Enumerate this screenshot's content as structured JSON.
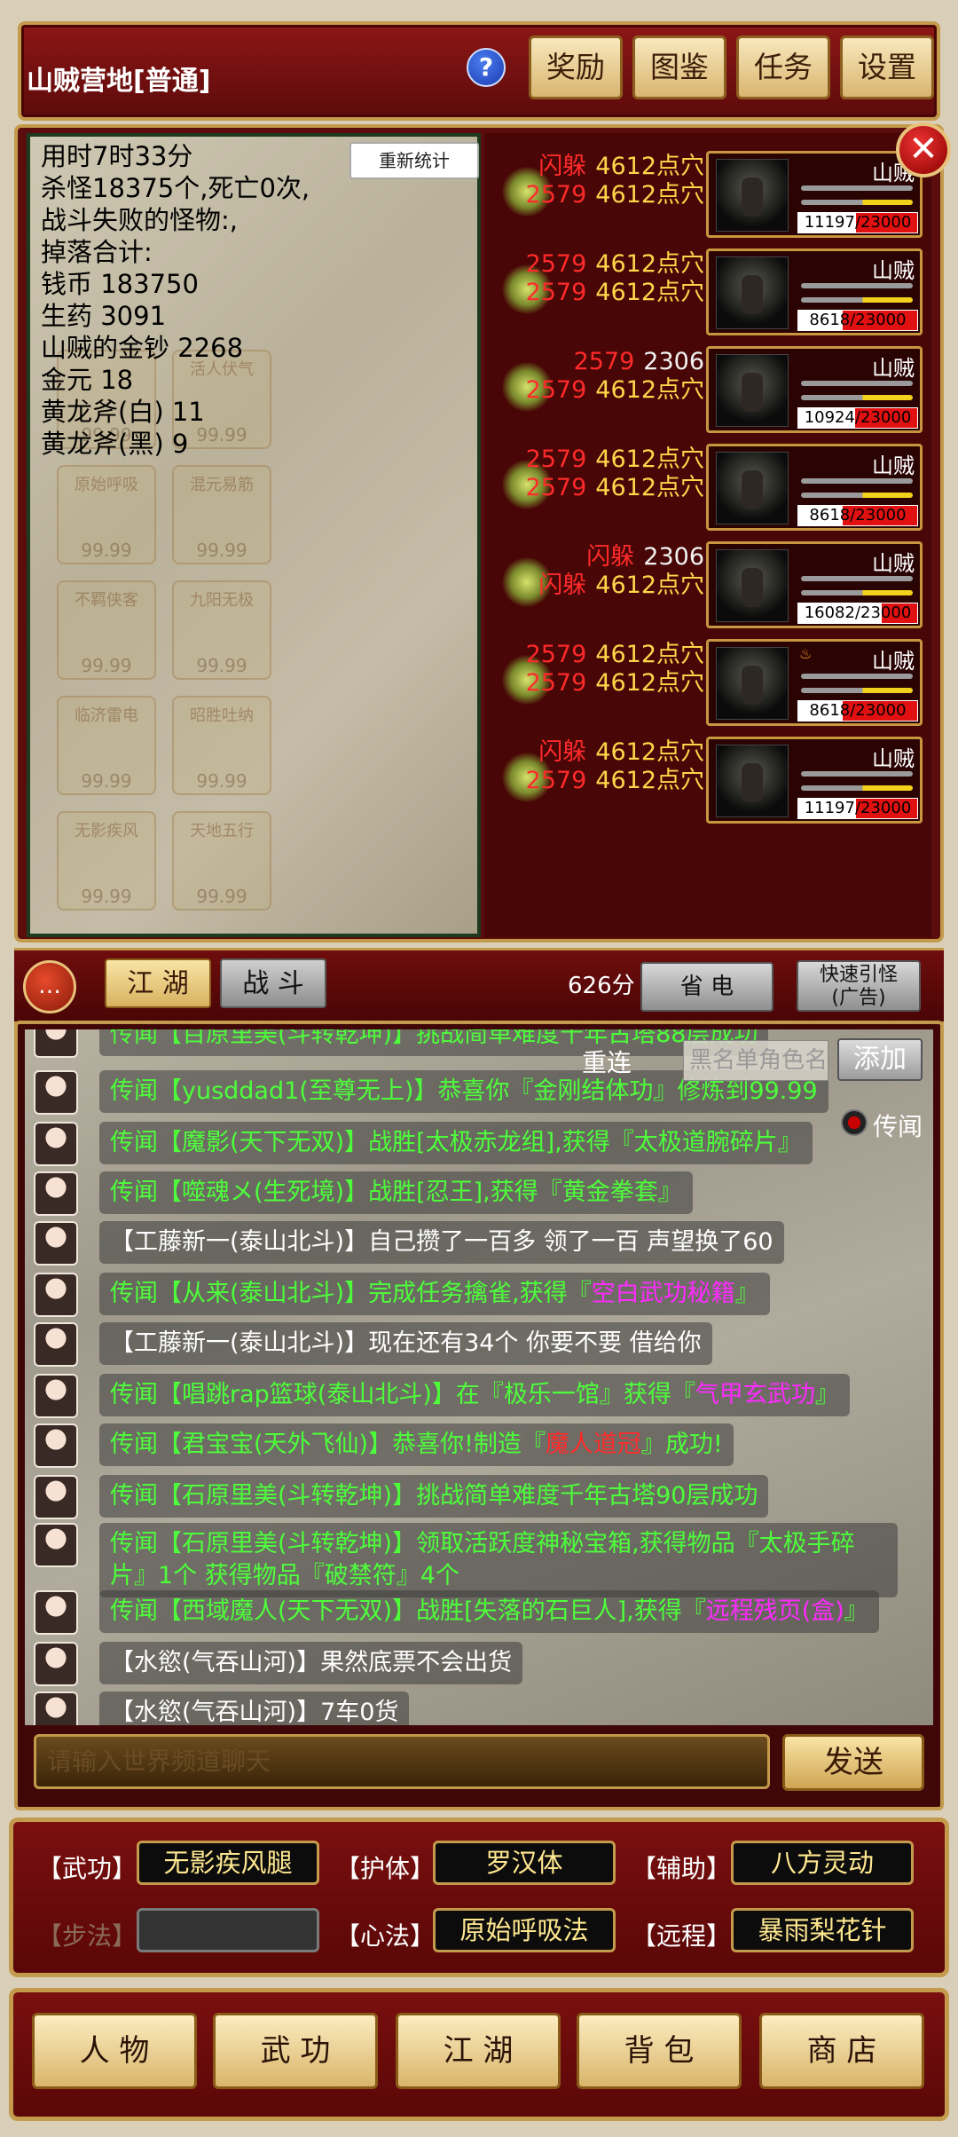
{
  "header": {
    "location": "山贼营地[普通]",
    "help_symbol": "?",
    "buttons": [
      "奖励",
      "图鉴",
      "任务",
      "设置"
    ]
  },
  "stats": {
    "recount_label": "重新统计",
    "lines": [
      "用时7时33分",
      "杀怪18375个,死亡0次,",
      "战斗失败的怪物:,",
      "掉落合计:",
      "钱币 183750",
      "生药 3091",
      "山贼的金钞 2268",
      "金元 18",
      "黄龙斧(白) 11",
      "黄龙斧(黑) 9"
    ],
    "faded_skills": [
      {
        "name": "",
        "value": "99.99"
      },
      {
        "name": "活人伏气",
        "value": "99.99"
      },
      {
        "name": "原始呼吸",
        "value": "99.99"
      },
      {
        "name": "混元易筋",
        "value": "99.99"
      },
      {
        "name": "不羁侠客",
        "value": "99.99"
      },
      {
        "name": "九阳无极",
        "value": "99.99"
      },
      {
        "name": "临济雷电",
        "value": "99.99"
      },
      {
        "name": "昭胜吐纳",
        "value": "99.99"
      },
      {
        "name": "无影疾风",
        "value": "99.99"
      },
      {
        "name": "天地五行",
        "value": "99.99"
      }
    ]
  },
  "close_symbol": "✕",
  "enemies": [
    {
      "name": "山贼",
      "line1": [
        {
          "t": "闪躲",
          "c": "red"
        },
        {
          "t": "4612点穴",
          "c": "yel"
        }
      ],
      "line2": [
        {
          "t": "2579",
          "c": "red"
        },
        {
          "t": "4612点穴",
          "c": "yel"
        }
      ],
      "hp": "11197/23000",
      "hp_fraction": 0.487
    },
    {
      "name": "山贼",
      "line1": [
        {
          "t": "2579",
          "c": "red"
        },
        {
          "t": "4612点穴",
          "c": "yel"
        }
      ],
      "line2": [
        {
          "t": "2579",
          "c": "red"
        },
        {
          "t": "4612点穴",
          "c": "yel"
        }
      ],
      "hp": "8618/23000",
      "hp_fraction": 0.375
    },
    {
      "name": "山贼",
      "line1": [
        {
          "t": "2579",
          "c": "red"
        },
        {
          "t": "2306",
          "c": "wht"
        }
      ],
      "line2": [
        {
          "t": "2579",
          "c": "red"
        },
        {
          "t": "4612点穴",
          "c": "yel"
        }
      ],
      "hp": "10924/23000",
      "hp_fraction": 0.475
    },
    {
      "name": "山贼",
      "line1": [
        {
          "t": "2579",
          "c": "red"
        },
        {
          "t": "4612点穴",
          "c": "yel"
        }
      ],
      "line2": [
        {
          "t": "2579",
          "c": "red"
        },
        {
          "t": "4612点穴",
          "c": "yel"
        }
      ],
      "hp": "8618/23000",
      "hp_fraction": 0.375
    },
    {
      "name": "山贼",
      "line1": [
        {
          "t": "闪躲",
          "c": "red"
        },
        {
          "t": "2306",
          "c": "wht"
        }
      ],
      "line2": [
        {
          "t": "闪躲",
          "c": "red"
        },
        {
          "t": "4612点穴",
          "c": "yel"
        }
      ],
      "hp": "16082/23000",
      "hp_fraction": 0.699
    },
    {
      "name": "山贼",
      "line1": [
        {
          "t": "2579",
          "c": "red"
        },
        {
          "t": "4612点穴",
          "c": "yel"
        }
      ],
      "line2": [
        {
          "t": "2579",
          "c": "red"
        },
        {
          "t": "4612点穴",
          "c": "yel"
        }
      ],
      "hp": "8618/23000",
      "hp_fraction": 0.375,
      "burning": true
    },
    {
      "name": "山贼",
      "line1": [
        {
          "t": "闪躲",
          "c": "red"
        },
        {
          "t": "4612点穴",
          "c": "yel"
        }
      ],
      "line2": [
        {
          "t": "2579",
          "c": "red"
        },
        {
          "t": "4612点穴",
          "c": "yel"
        }
      ],
      "hp": "11197/23000",
      "hp_fraction": 0.487
    }
  ],
  "tabs": {
    "chat_icon": "…",
    "jianghu": "江 湖",
    "battle": "战 斗",
    "score": "626分",
    "power_save": "省 电",
    "quick_lure": "快速引怪\n(广告)"
  },
  "chat": {
    "reconnect": "重连",
    "blacklist_placeholder": "黑名单角色名",
    "add_label": "添加",
    "channel_label": "传闻",
    "input_placeholder": "请输入世界频道聊天",
    "send_label": "发送",
    "messages": [
      {
        "segs": [
          {
            "c": "g",
            "t": "传闻【百原里美(斗转乾坤)】挑战简单难度千年古塔88层成功"
          }
        ]
      },
      {
        "segs": [
          {
            "c": "g",
            "t": "传闻【yusddad1(至尊无上)】恭喜你『金刚结体功』修炼到99.99"
          }
        ]
      },
      {
        "segs": [
          {
            "c": "g",
            "t": "传闻【魔影(天下无双)】战胜[太极赤龙组],获得『太极道腕碎片』"
          }
        ]
      },
      {
        "segs": [
          {
            "c": "g",
            "t": "传闻【噬魂メ(生死境)】战胜[忍王],获得『黄金拳套』"
          }
        ]
      },
      {
        "segs": [
          {
            "c": "w",
            "t": "【工藤新一(泰山北斗)】自己攒了一百多  领了一百  声望换了60"
          }
        ]
      },
      {
        "segs": [
          {
            "c": "g",
            "t": "传闻【从来(泰山北斗)】完成任务擒雀,获得『"
          },
          {
            "c": "m",
            "t": "空白武功秘籍"
          },
          {
            "c": "g",
            "t": "』"
          }
        ]
      },
      {
        "segs": [
          {
            "c": "w",
            "t": "【工藤新一(泰山北斗)】现在还有34个 你要不要  借给你"
          }
        ]
      },
      {
        "segs": [
          {
            "c": "g",
            "t": "传闻【唱跳rap篮球(泰山北斗)】在『极乐一馆』获得『"
          },
          {
            "c": "m",
            "t": "气甲玄武功"
          },
          {
            "c": "g",
            "t": "』"
          }
        ]
      },
      {
        "segs": [
          {
            "c": "g",
            "t": "传闻【君宝宝(天外飞仙)】恭喜你!制造『"
          },
          {
            "c": "r",
            "t": "魔人道冠"
          },
          {
            "c": "g",
            "t": "』成功!"
          }
        ]
      },
      {
        "segs": [
          {
            "c": "g",
            "t": "传闻【石原里美(斗转乾坤)】挑战简单难度千年古塔90层成功"
          }
        ]
      },
      {
        "multi": true,
        "segs": [
          {
            "c": "g",
            "t": "传闻【石原里美(斗转乾坤)】领取活跃度神秘宝箱,获得物品『太极手碎片』1个 获得物品『破禁符』4个"
          }
        ]
      },
      {
        "segs": [
          {
            "c": "g",
            "t": "传闻【西域魔人(天下无双)】战胜[失落的石巨人],获得『"
          },
          {
            "c": "m",
            "t": "远程残页(盒)"
          },
          {
            "c": "g",
            "t": "』"
          }
        ]
      },
      {
        "segs": [
          {
            "c": "w",
            "t": "【水慾(气吞山河)】果然底票不会出货"
          }
        ]
      },
      {
        "segs": [
          {
            "c": "w",
            "t": "【水慾(气吞山河)】7车0货"
          }
        ]
      }
    ]
  },
  "skills": {
    "martial_label": "【武功】",
    "martial": "无影疾风腿",
    "body_label": "【护体】",
    "body": "罗汉体",
    "assist_label": "【辅助】",
    "assist": "八方灵动",
    "step_label": "【步法】",
    "step": "",
    "mind_label": "【心法】",
    "mind": "原始呼吸法",
    "ranged_label": "【远程】",
    "ranged": "暴雨梨花针"
  },
  "nav": [
    "人 物",
    "武 功",
    "江 湖",
    "背 包",
    "商 店"
  ]
}
